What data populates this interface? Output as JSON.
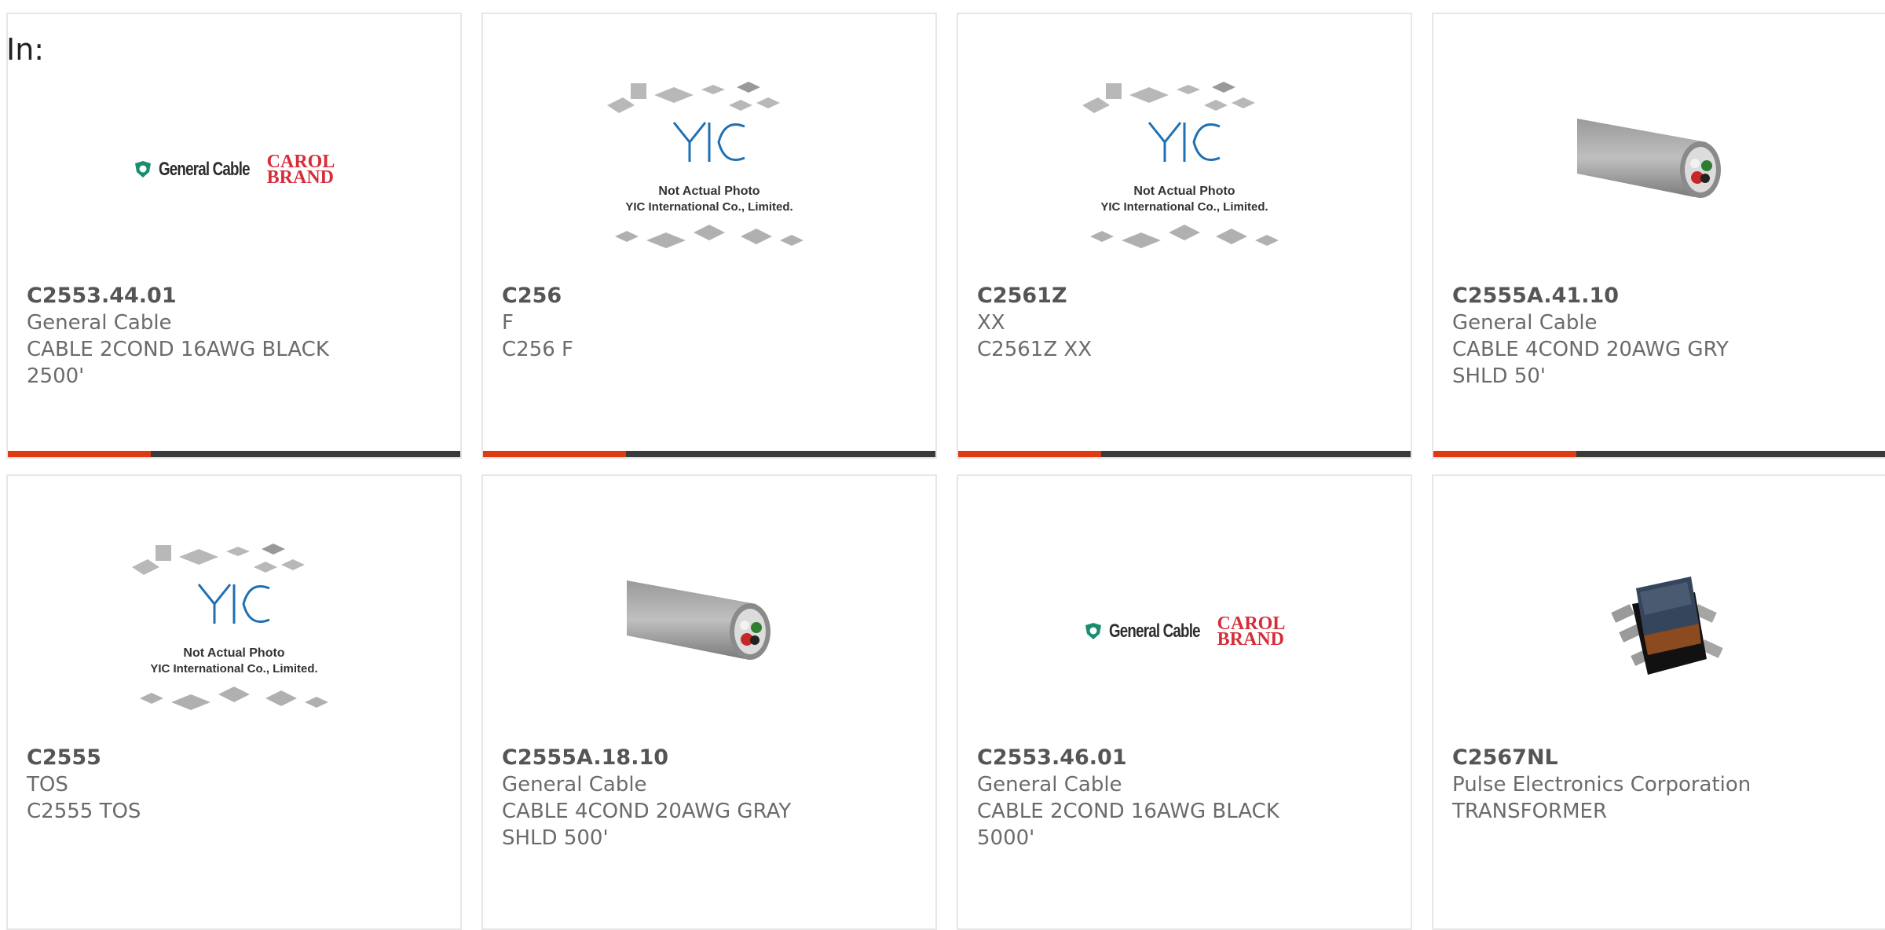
{
  "page": {
    "label": "In:"
  },
  "cards": [
    {
      "part": "C2553.44.01",
      "maker": "General Cable",
      "desc": "CABLE 2COND 16AWG BLACK 2500'",
      "image": "general-cable-logo"
    },
    {
      "part": "C256",
      "maker": "F",
      "desc": "C256 F",
      "image": "yic-placeholder"
    },
    {
      "part": "C2561Z",
      "maker": "XX",
      "desc": "C2561Z XX",
      "image": "yic-placeholder"
    },
    {
      "part": "C2555A.41.10",
      "maker": "General Cable",
      "desc": "CABLE 4COND 20AWG GRY SHLD 50'",
      "image": "gray-cable-photo"
    },
    {
      "part": "C2555",
      "maker": "TOS",
      "desc": "C2555 TOS",
      "image": "yic-placeholder"
    },
    {
      "part": "C2555A.18.10",
      "maker": "General Cable",
      "desc": "CABLE 4COND 20AWG GRAY SHLD 500'",
      "image": "gray-cable-photo"
    },
    {
      "part": "C2553.46.01",
      "maker": "General Cable",
      "desc": "CABLE 2COND 16AWG BLACK 5000'",
      "image": "general-cable-logo"
    },
    {
      "part": "C2567NL",
      "maker": "Pulse Electronics Corporation",
      "desc": "TRANSFORMER",
      "image": "transformer-photo"
    }
  ],
  "logos": {
    "general_cable": "General Cable",
    "carol_line1": "CAROL",
    "carol_line2": "BRAND"
  },
  "placeholder": {
    "brand": "YIC",
    "line1": "Not Actual Photo",
    "line2": "YIC International Co., Limited."
  },
  "colors": {
    "accent": "#e03a12",
    "bar": "#3a3a3a",
    "text": "#6b6b6b",
    "card_border": "#e6e6e6"
  }
}
